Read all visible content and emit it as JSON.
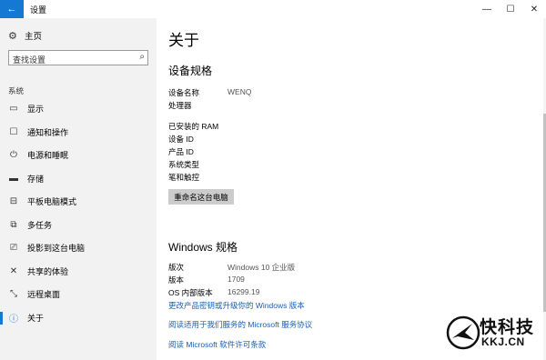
{
  "window": {
    "title": "设置",
    "back_icon": "←",
    "minimize_icon": "—",
    "maximize_icon": "☐",
    "close_icon": "✕"
  },
  "sidebar": {
    "home_label": "主页",
    "home_icon": "⚙",
    "search_placeholder": "查找设置",
    "search_icon": "⌕",
    "section_label": "系统",
    "items": [
      {
        "label": "显示",
        "icon": "▭"
      },
      {
        "label": "通知和操作",
        "icon": "☐"
      },
      {
        "label": "电源和睡眠",
        "icon": "⏻"
      },
      {
        "label": "存储",
        "icon": "▬"
      },
      {
        "label": "平板电脑模式",
        "icon": "⊟"
      },
      {
        "label": "多任务",
        "icon": "⧉"
      },
      {
        "label": "投影到这台电脑",
        "icon": "⎚"
      },
      {
        "label": "共享的体验",
        "icon": "✕"
      },
      {
        "label": "远程桌面",
        "icon": "⤡"
      },
      {
        "label": "关于",
        "icon": "ⓘ"
      }
    ],
    "active_index": 9
  },
  "main": {
    "title": "关于",
    "device_spec_heading": "设备规格",
    "device_name_label": "设备名称",
    "device_name_value": "WENQ",
    "processor_label": "处理器",
    "ram_label": "已安装的 RAM",
    "device_id_label": "设备 ID",
    "product_id_label": "产品 ID",
    "system_type_label": "系统类型",
    "pen_touch_label": "笔和触控",
    "rename_button": "重命名这台电脑",
    "windows_spec_heading": "Windows 规格",
    "edition_label": "版次",
    "edition_value": "Windows 10 企业版",
    "version_label": "版本",
    "version_value": "1709",
    "os_build_label": "OS 内部版本",
    "os_build_value": "16299.19",
    "link_change_key": "更改产品密钥或升级你的 Windows 版本",
    "link_service_agreement": "阅读适用于我们服务的 Microsoft 服务协议",
    "link_license": "阅读 Microsoft 软件许可条款"
  },
  "watermark": {
    "main": "快科技",
    "sub": "KKJ.CN"
  },
  "colors": {
    "accent": "#1579d4",
    "sidebar_bg": "#f2f2f2",
    "link": "#1a5fb4"
  }
}
